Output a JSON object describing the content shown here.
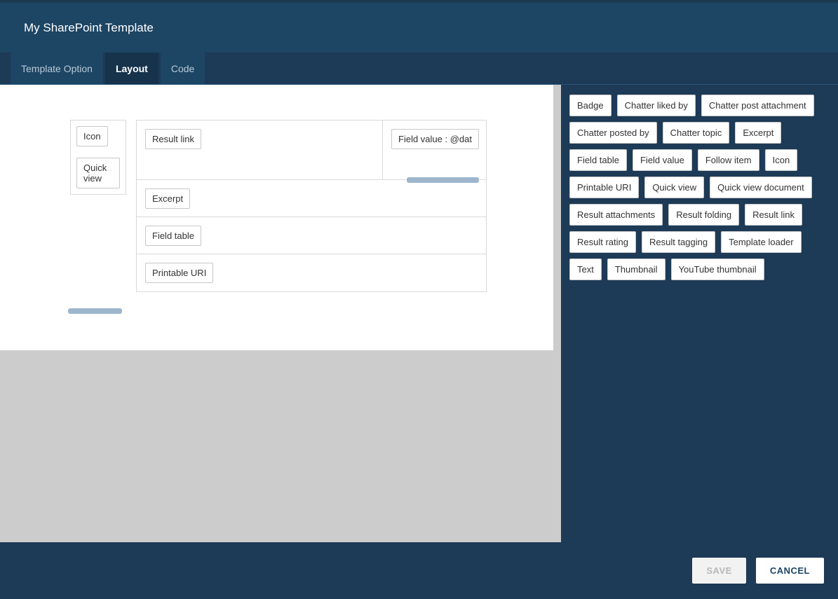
{
  "header": {
    "title": "My SharePoint Template"
  },
  "tabs": [
    {
      "label": "Template Option",
      "active": false
    },
    {
      "label": "Layout",
      "active": true
    },
    {
      "label": "Code",
      "active": false
    }
  ],
  "layout": {
    "leftColumn": [
      {
        "label": "Icon"
      },
      {
        "label": "Quick view"
      }
    ],
    "rightColumn": {
      "row1_left": "Result link",
      "row1_right": "Field value : @dat",
      "rows": [
        "Excerpt",
        "Field table",
        "Printable URI"
      ]
    }
  },
  "palette": [
    "Badge",
    "Chatter liked by",
    "Chatter post attachment",
    "Chatter posted by",
    "Chatter topic",
    "Excerpt",
    "Field table",
    "Field value",
    "Follow item",
    "Icon",
    "Printable URI",
    "Quick view",
    "Quick view document",
    "Result attachments",
    "Result folding",
    "Result link",
    "Result rating",
    "Result tagging",
    "Template loader",
    "Text",
    "Thumbnail",
    "YouTube thumbnail"
  ],
  "footer": {
    "save": "SAVE",
    "cancel": "CANCEL"
  }
}
